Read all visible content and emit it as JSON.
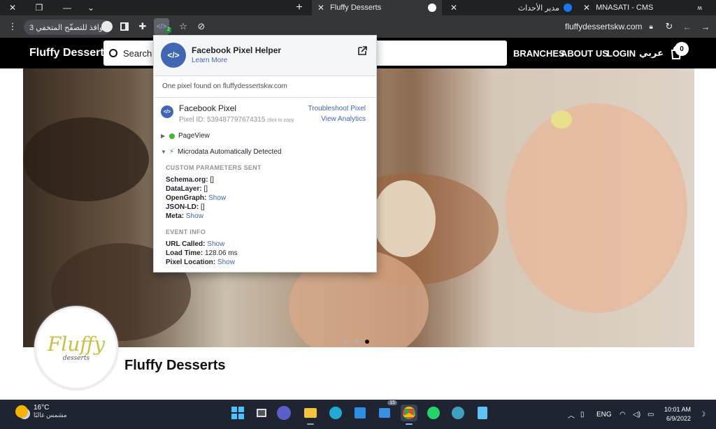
{
  "browser": {
    "tabs": [
      {
        "title": "MNASATI - CMS"
      },
      {
        "title": "مدير الأحداث"
      },
      {
        "title": "Fluffy Desserts"
      }
    ],
    "new_tab_label": "+",
    "profile_chip": "3 نوافذ للتصفّح المتخفي",
    "url": "fluffydessertskw.com",
    "extension_badge": "2"
  },
  "site": {
    "brand": "Fluffy Desserts",
    "search_placeholder": "Search",
    "nav": {
      "branches": "BRANCHES",
      "about": "ABOUT US",
      "login": "LOGIN",
      "lang": "عربي"
    },
    "cart_count": "0",
    "logo_word": "Fluffy",
    "logo_sub": "desserts",
    "store_title": "Fluffy Desserts",
    "carousel": {
      "slides": 3,
      "active": 3
    }
  },
  "pixel_helper": {
    "title": "Facebook Pixel Helper",
    "learn_more": "Learn More",
    "found": "One pixel found on fluffydessertskw.com",
    "pixel_name": "Facebook Pixel",
    "pixel_id_label": "Pixel ID: 539487797674315",
    "click_to_copy": "click to copy",
    "troubleshoot": "Troubleshoot Pixel",
    "view_analytics": "View Analytics",
    "event_pageview": "PageView",
    "event_microdata": "Microdata Automatically Detected",
    "custom_params_heading": "CUSTOM PARAMETERS SENT",
    "params": {
      "schema_key": "Schema.org:",
      "schema_val": "[]",
      "datalayer_key": "DataLayer:",
      "datalayer_val": "[]",
      "opengraph_key": "OpenGraph:",
      "opengraph_val": "Show",
      "jsonld_key": "JSON-LD:",
      "jsonld_val": "[]",
      "meta_key": "Meta:",
      "meta_val": "Show"
    },
    "event_info_heading": "EVENT INFO",
    "event_info": {
      "url_key": "URL Called:",
      "url_val": "Show",
      "load_key": "Load Time:",
      "load_val": "128.06 ms",
      "loc_key": "Pixel Location:",
      "loc_val": "Show"
    }
  },
  "taskbar": {
    "temp": "16°C",
    "weather_desc": "مشمس غالبًا",
    "badge_count": "15",
    "lang": "ENG",
    "time": "10:01 AM",
    "date": "6/9/2022"
  },
  "colors": {
    "fb_blue": "#4267b2",
    "chrome_dark": "#202124",
    "site_black": "#000000",
    "taskbar": "#1f2433"
  }
}
